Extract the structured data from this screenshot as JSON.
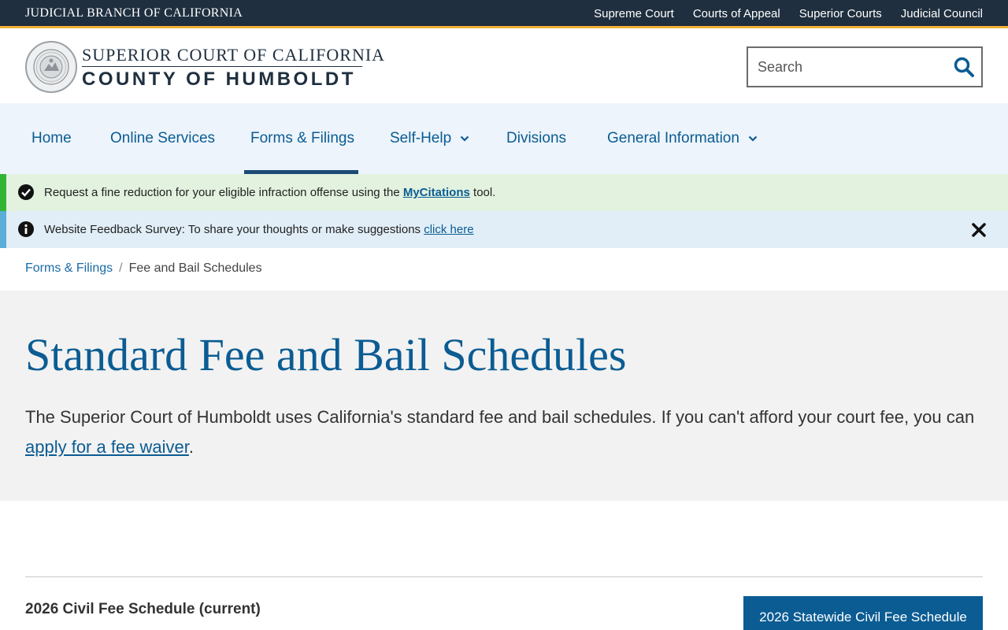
{
  "topbar": {
    "brand": "JUDICIAL BRANCH OF CALIFORNIA",
    "links": [
      "Supreme Court",
      "Courts of Appeal",
      "Superior Courts",
      "Judicial Council"
    ]
  },
  "header": {
    "line1": "SUPERIOR COURT OF CALIFORNIA",
    "line2": "COUNTY OF HUMBOLDT",
    "seal_icon": "court-seal-icon",
    "search_placeholder": "Search"
  },
  "nav": {
    "items": [
      {
        "label": "Home",
        "dropdown": false
      },
      {
        "label": "Online Services",
        "dropdown": false
      },
      {
        "label": "Forms & Filings",
        "dropdown": false,
        "active": true
      },
      {
        "label": "Self-Help",
        "dropdown": true
      },
      {
        "label": "Divisions",
        "dropdown": false
      },
      {
        "label": "General Information",
        "dropdown": true
      }
    ]
  },
  "alerts": {
    "citation": {
      "text_before": "Request a fine reduction for your eligible infraction offense using the ",
      "link": "MyCitations",
      "text_after": " tool."
    },
    "survey": {
      "label": "Website Feedback Survey:",
      "text": " To share your thoughts or make suggestions ",
      "link": "click here"
    }
  },
  "breadcrumb": {
    "parent": "Forms & Filings",
    "separator": "/",
    "current": "Fee and Bail Schedules"
  },
  "hero": {
    "title": "Standard Fee and Bail Schedules",
    "intro_before": "The Superior Court of Humboldt uses California's standard fee and bail schedules. If you can't afford your court fee, you can ",
    "intro_link": "apply for a fee waiver",
    "intro_after": "."
  },
  "content": {
    "section_title": "2026 Civil Fee Schedule (current)",
    "cta_label": "2026 Statewide Civil Fee Schedule"
  },
  "colors": {
    "topbar": "#1f2f3f",
    "accent_gold": "#f2b135",
    "brand_blue": "#0b5c93",
    "nav_bg": "#edf4fb",
    "success_green": "#32b535",
    "info_blue": "#5aaed8"
  }
}
